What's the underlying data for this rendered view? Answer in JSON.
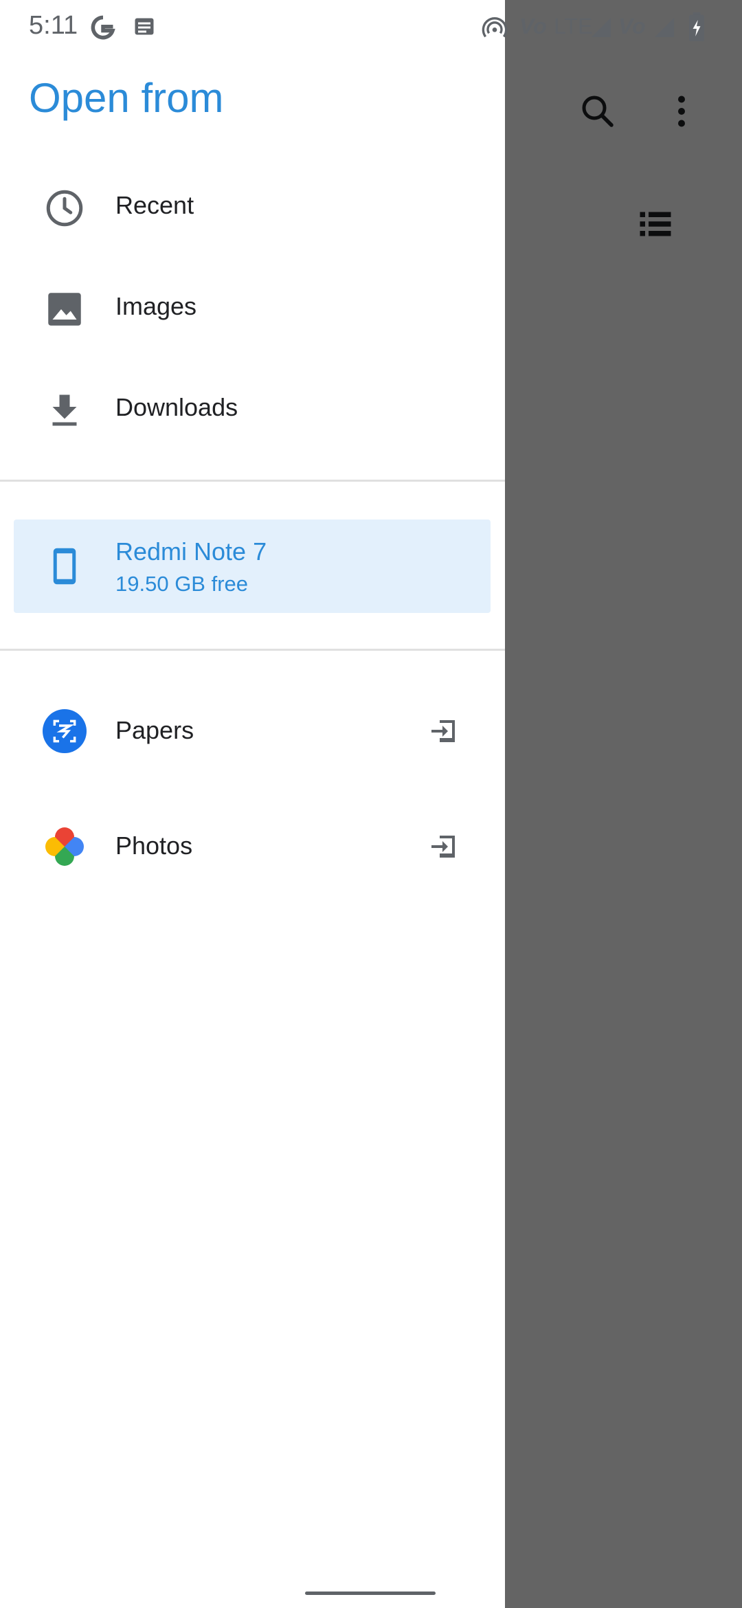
{
  "status_bar": {
    "time": "5:11",
    "network_label": "LTE",
    "volte_1": "Vo",
    "volte_2": "Vo"
  },
  "drawer": {
    "title": "Open from",
    "items": [
      {
        "label": "Recent",
        "icon": "clock-icon"
      },
      {
        "label": "Images",
        "icon": "image-icon"
      },
      {
        "label": "Downloads",
        "icon": "download-icon"
      }
    ],
    "device": {
      "name": "Redmi Note 7",
      "free": "19.50 GB free",
      "icon": "phone-icon"
    },
    "apps": [
      {
        "label": "Papers",
        "icon": "papers-app-icon"
      },
      {
        "label": "Photos",
        "icon": "photos-app-icon"
      }
    ]
  },
  "colors": {
    "accent": "#2b8bd8",
    "selected_bg": "#e3f0fc",
    "scrim": "#666666"
  }
}
